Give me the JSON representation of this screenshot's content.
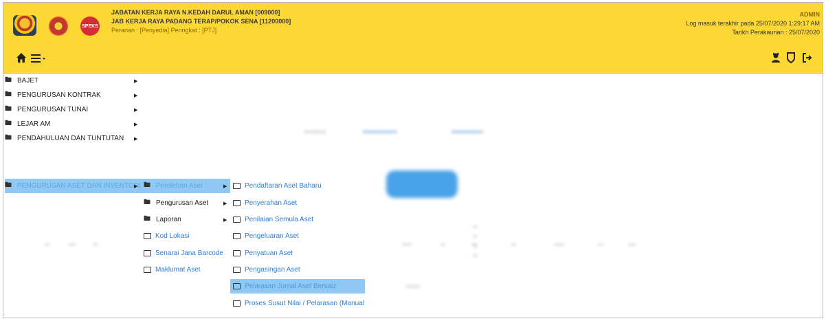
{
  "header": {
    "line1": "JABATAN KERJA RAYA N.KEDAH DARUL AMAN [009000]",
    "line2": "JAB KERJA RAYA PADANG TERAP/POKOK SENA [11200000]",
    "line3": "Peranan : [Penyedia] Peringkat : [PTJ]",
    "user": "ADMIN",
    "last_login": "Log masuk terakhir pada 25/07/2020 1:29:17 AM",
    "settlement_date": "Tarikh Perakaunan : 25/07/2020",
    "logo3_text": "SPEKS"
  },
  "toolbar": {
    "home_icon": "home-icon",
    "menu_icon": "hamburger-menu-icon",
    "right_icons": [
      "user-icon",
      "shield-icon",
      "logout-icon"
    ]
  },
  "main_menu": {
    "items": [
      {
        "label": "BAJET"
      },
      {
        "label": "PENGURUSAN KONTRAK"
      },
      {
        "label": "PENGURUSAN TUNAI"
      },
      {
        "label": "LEJAR AM"
      },
      {
        "label": "PENDAHULUAN DAN TUNTUTAN"
      },
      {
        "label": "PENGURUSAN ASET DAN INVENTORI"
      }
    ]
  },
  "submenu1": {
    "items": [
      {
        "label": "Perolehan Aset"
      },
      {
        "label": "Pengurusan Aset"
      },
      {
        "label": "Laporan"
      },
      {
        "label": "Kod Lokasi"
      },
      {
        "label": "Senarai Jana Barcode"
      },
      {
        "label": "Maklumat Aset"
      }
    ]
  },
  "submenu2": {
    "items": [
      {
        "label": "Pendaftaran Aset Baharu"
      },
      {
        "label": "Penyerahan Aset"
      },
      {
        "label": "Penilaian Semula Aset"
      },
      {
        "label": "Pengeluaran Aset"
      },
      {
        "label": "Penyatuan Aset"
      },
      {
        "label": "Pengasingan Aset"
      },
      {
        "label": "Pelarasan Jurnal Aset Bersaiz"
      },
      {
        "label": "Proses Susut Nilai / Pelarasan (Manual"
      }
    ]
  }
}
